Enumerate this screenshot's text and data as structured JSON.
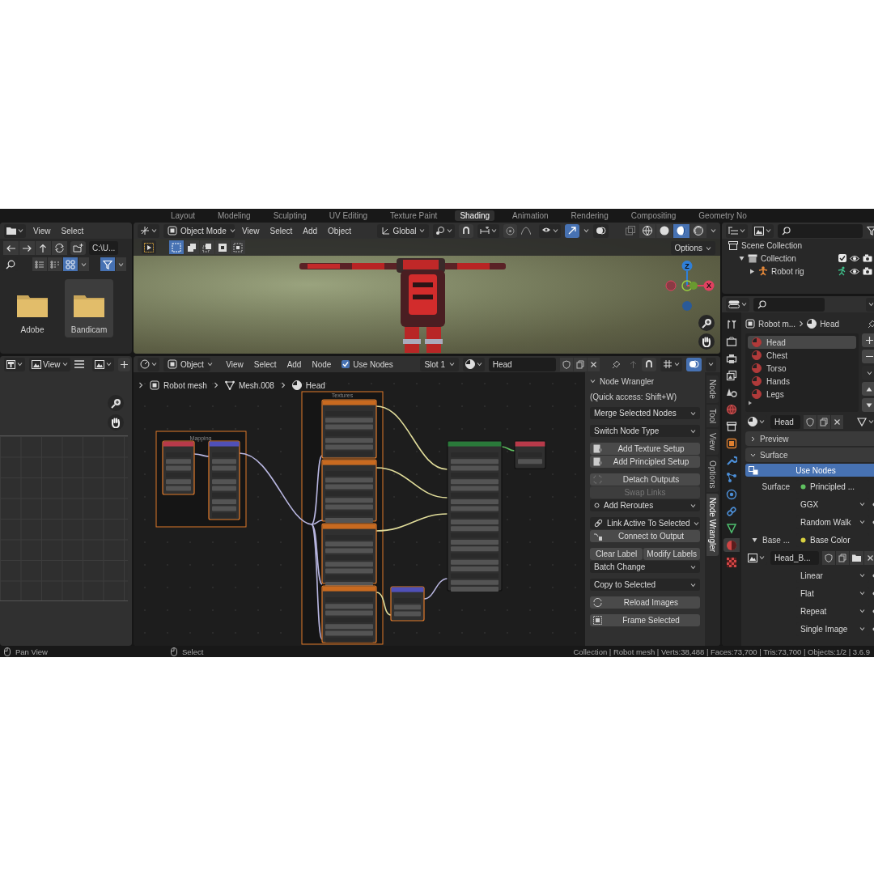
{
  "workspace_tabs": [
    {
      "label": "Layout",
      "selected": false
    },
    {
      "label": "Modeling",
      "selected": false
    },
    {
      "label": "Sculpting",
      "selected": false
    },
    {
      "label": "UV Editing",
      "selected": false
    },
    {
      "label": "Texture Paint",
      "selected": false
    },
    {
      "label": "Shading",
      "selected": true
    },
    {
      "label": "Animation",
      "selected": false
    },
    {
      "label": "Rendering",
      "selected": false
    },
    {
      "label": "Compositing",
      "selected": false
    },
    {
      "label": "Geometry No",
      "selected": false
    }
  ],
  "file_browser": {
    "menus": [
      "View",
      "Select"
    ],
    "path": "C:\\U...",
    "folders": [
      {
        "name": "Adobe",
        "selected": false
      },
      {
        "name": "Bandicam",
        "selected": true
      }
    ]
  },
  "viewport": {
    "mode": "Object Mode",
    "menus": [
      "View",
      "Select",
      "Add",
      "Object"
    ],
    "orientation": "Global",
    "shading_modes": [
      {
        "kind": "wireframe",
        "selected": false
      },
      {
        "kind": "solid",
        "selected": false
      },
      {
        "kind": "material",
        "selected": true
      },
      {
        "kind": "rendered",
        "selected": false
      }
    ],
    "options": "Options",
    "gizmo": {
      "z": "Z",
      "x": "X"
    }
  },
  "outliner": {
    "tree": [
      {
        "label": "Scene Collection",
        "kind": "scene",
        "children": [
          {
            "label": "Collection",
            "kind": "collection",
            "checked": true,
            "expanded": true,
            "children": [
              {
                "label": "Robot rig",
                "kind": "armature",
                "expanded": false
              }
            ]
          }
        ]
      }
    ]
  },
  "image_editor": {
    "menus": [
      "View"
    ]
  },
  "node_editor": {
    "object_type": "Object",
    "menus": [
      "View",
      "Select",
      "Add",
      "Node"
    ],
    "use_nodes": {
      "label": "Use Nodes",
      "checked": true
    },
    "slot": "Slot 1",
    "material": "Head",
    "breadcrumbs": [
      "Robot mesh",
      "Mesh.008",
      "Head"
    ],
    "frames": [
      "Mapping",
      "Textures"
    ]
  },
  "sidebar": {
    "title": "Node Wrangler",
    "hint": "(Quick access: Shift+W)",
    "groups": [
      [
        {
          "kind": "dropdown",
          "label": "Merge Selected Nodes",
          "disabled": false
        }
      ],
      [
        {
          "kind": "dropdown",
          "label": "Switch Node Type",
          "disabled": false
        }
      ],
      [
        {
          "kind": "button",
          "label": "Add Texture Setup",
          "disabled": false
        },
        {
          "kind": "button",
          "label": "Add Principled Setup",
          "disabled": false
        }
      ],
      [
        {
          "kind": "button",
          "label": "Detach Outputs",
          "disabled": false
        },
        {
          "kind": "button",
          "label": "Swap Links",
          "disabled": true
        },
        {
          "kind": "dropdown",
          "label": "Add Reroutes",
          "disabled": false
        }
      ],
      [
        {
          "kind": "dropdown",
          "label": "Link Active To Selected",
          "disabled": false
        },
        {
          "kind": "button",
          "label": "Connect to Output",
          "disabled": false
        }
      ],
      [
        {
          "kind": "pair",
          "labels": [
            "Clear Label",
            "Modify Labels"
          ],
          "disabled": false
        },
        {
          "kind": "dropdown",
          "label": "Batch Change",
          "disabled": false
        }
      ],
      [
        {
          "kind": "dropdown",
          "label": "Copy to Selected",
          "disabled": false
        }
      ],
      [
        {
          "kind": "button",
          "label": "Reload Images",
          "disabled": false
        }
      ],
      [
        {
          "kind": "button",
          "label": "Frame Selected",
          "disabled": false
        }
      ]
    ],
    "tabs": [
      {
        "label": "Node",
        "selected": false
      },
      {
        "label": "Tool",
        "selected": false
      },
      {
        "label": "View",
        "selected": false
      },
      {
        "label": "Options",
        "selected": false
      },
      {
        "label": "Node Wrangler",
        "selected": true
      }
    ]
  },
  "properties": {
    "tabs": [
      {
        "kind": "tool",
        "selected": false
      },
      {
        "kind": "render",
        "selected": false
      },
      {
        "kind": "output",
        "selected": false
      },
      {
        "kind": "view_layer",
        "selected": false
      },
      {
        "kind": "scene",
        "selected": false
      },
      {
        "kind": "world",
        "selected": false
      },
      {
        "kind": "collection",
        "selected": false
      },
      {
        "kind": "object",
        "selected": false
      },
      {
        "kind": "modifier",
        "selected": false
      },
      {
        "kind": "particles",
        "selected": false
      },
      {
        "kind": "physics",
        "selected": false
      },
      {
        "kind": "constraints",
        "selected": false
      },
      {
        "kind": "data",
        "selected": false
      },
      {
        "kind": "material",
        "selected": true
      },
      {
        "kind": "texture",
        "selected": false
      }
    ],
    "breadcrumb": [
      "Robot m...",
      "Head"
    ],
    "materials": [
      {
        "name": "Head",
        "selected": true
      },
      {
        "name": "Chest",
        "selected": false
      },
      {
        "name": "Torso",
        "selected": false
      },
      {
        "name": "Hands",
        "selected": false
      },
      {
        "name": "Legs",
        "selected": false
      }
    ],
    "material_field": "Head",
    "panels": [
      {
        "label": "Preview",
        "expanded": false
      },
      {
        "label": "Surface",
        "expanded": true
      }
    ],
    "use_nodes": "Use Nodes",
    "surface": {
      "label": "Surface",
      "value": "Principled ..."
    },
    "shader_options": [
      "GGX",
      "Random Walk"
    ],
    "base_color": {
      "label": "Base ...",
      "value": "Base Color",
      "expanded": true
    },
    "image": "Head_B...",
    "image_options": [
      "Linear",
      "Flat",
      "Repeat",
      "Single Image"
    ]
  },
  "status_bar": {
    "left": "Pan View",
    "middle": "Select",
    "right": "Collection | Robot mesh | Verts:38,488 | Faces:73,700 | Tris:73,700 | Objects:1/2 | 3.6.9"
  }
}
